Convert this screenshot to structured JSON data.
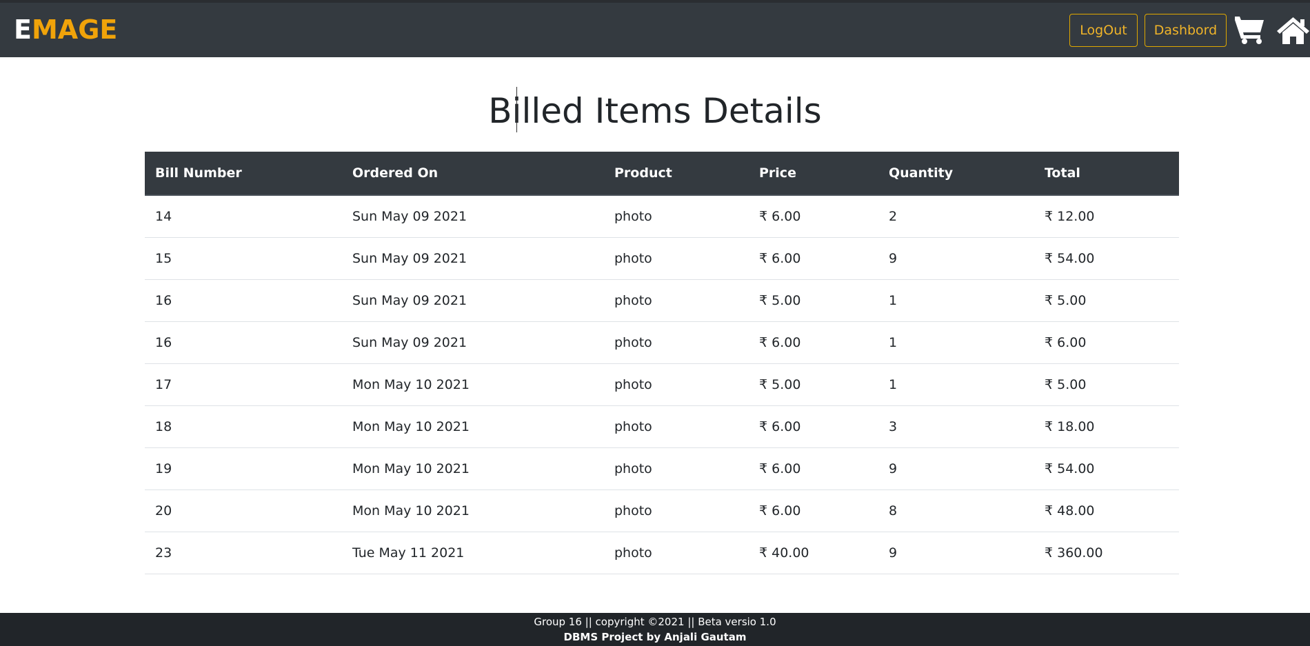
{
  "brand": {
    "first_letter": "E",
    "rest": "MAGE",
    "first_color": "#ffffff",
    "accent_color": "#f0a30a"
  },
  "nav": {
    "logout_label": "LogOut",
    "dashboard_label": "Dashbord",
    "cart_icon": "shopping-cart-icon",
    "home_icon": "home-icon"
  },
  "page": {
    "title": "Billed Items Details"
  },
  "table": {
    "headers": [
      "Bill Number",
      "Ordered On",
      "Product",
      "Price",
      "Quantity",
      "Total"
    ],
    "rows": [
      [
        "14",
        "Sun May 09 2021",
        "photo",
        "₹ 6.00",
        "2",
        "₹ 12.00"
      ],
      [
        "15",
        "Sun May 09 2021",
        "photo",
        "₹ 6.00",
        "9",
        "₹ 54.00"
      ],
      [
        "16",
        "Sun May 09 2021",
        "photo",
        "₹ 5.00",
        "1",
        "₹ 5.00"
      ],
      [
        "16",
        "Sun May 09 2021",
        "photo",
        "₹ 6.00",
        "1",
        "₹ 6.00"
      ],
      [
        "17",
        "Mon May 10 2021",
        "photo",
        "₹ 5.00",
        "1",
        "₹ 5.00"
      ],
      [
        "18",
        "Mon May 10 2021",
        "photo",
        "₹ 6.00",
        "3",
        "₹ 18.00"
      ],
      [
        "19",
        "Mon May 10 2021",
        "photo",
        "₹ 6.00",
        "9",
        "₹ 54.00"
      ],
      [
        "20",
        "Mon May 10 2021",
        "photo",
        "₹ 6.00",
        "8",
        "₹ 48.00"
      ],
      [
        "23",
        "Tue May 11 2021",
        "photo",
        "₹ 40.00",
        "9",
        "₹ 360.00"
      ]
    ]
  },
  "footer": {
    "line1": "Group 16 || copyright ©2021 || Beta versio 1.0",
    "line2": "DBMS Project by Anjali Gautam"
  },
  "colors": {
    "navbar_bg": "#343a40",
    "footer_bg": "#212529",
    "button_accent": "#f0b429"
  }
}
